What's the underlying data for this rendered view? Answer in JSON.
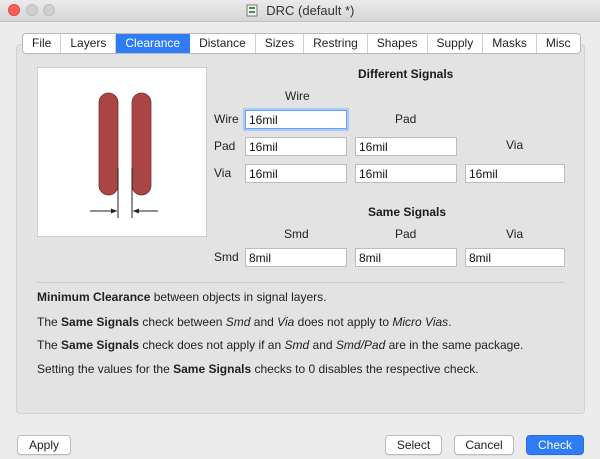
{
  "window": {
    "title": "DRC (default *)"
  },
  "tabs": [
    {
      "label": "File"
    },
    {
      "label": "Layers"
    },
    {
      "label": "Clearance",
      "active": true
    },
    {
      "label": "Distance"
    },
    {
      "label": "Sizes"
    },
    {
      "label": "Restring"
    },
    {
      "label": "Shapes"
    },
    {
      "label": "Supply"
    },
    {
      "label": "Masks"
    },
    {
      "label": "Misc"
    }
  ],
  "different_signals": {
    "heading": "Different Signals",
    "columns": {
      "wire": "Wire",
      "pad": "Pad",
      "via": "Via"
    },
    "rows": {
      "wire": {
        "label": "Wire",
        "wire": "16mil"
      },
      "pad": {
        "label": "Pad",
        "wire": "16mil",
        "pad": "16mil"
      },
      "via": {
        "label": "Via",
        "wire": "16mil",
        "pad": "16mil",
        "via": "16mil"
      }
    }
  },
  "same_signals": {
    "heading": "Same Signals",
    "columns": {
      "smd": "Smd",
      "pad": "Pad",
      "via": "Via"
    },
    "row": {
      "label": "Smd",
      "smd": "8mil",
      "pad": "8mil",
      "via": "8mil"
    }
  },
  "notes": {
    "line1": {
      "b1": "Minimum Clearance",
      "t1": " between objects in signal layers."
    },
    "line2": {
      "t1": "The ",
      "b1": "Same Signals",
      "t2": " check between ",
      "i1": "Smd",
      "t3": " and ",
      "i2": "Via",
      "t4": " does not apply to ",
      "i3": "Micro Vias",
      "t5": "."
    },
    "line3": {
      "t1": "The ",
      "b1": "Same Signals",
      "t2": " check does not apply if an ",
      "i1": "Smd",
      "t3": " and ",
      "i2": "Smd/Pad",
      "t4": " are in the same package."
    },
    "line4": {
      "t1": "Setting the values for the ",
      "b1": "Same Signals",
      "t2": " checks to 0 disables the respective check."
    }
  },
  "buttons": {
    "apply": "Apply",
    "select": "Select",
    "cancel": "Cancel",
    "check": "Check"
  },
  "colors": {
    "accent": "#2f7df6",
    "trace": "#a94545"
  }
}
